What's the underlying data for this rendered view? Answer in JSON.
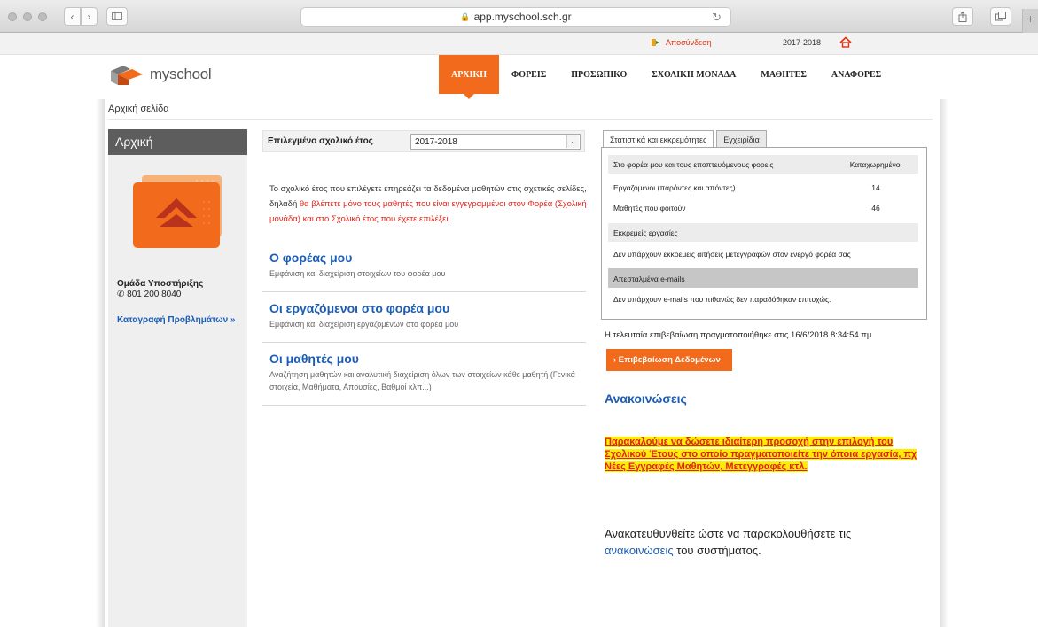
{
  "browser": {
    "url": "app.myschool.sch.gr",
    "icons": [
      "close-dot",
      "minimize-dot",
      "zoom-dot",
      "back-icon",
      "forward-icon",
      "sidebar-icon",
      "lock-icon",
      "reload-icon",
      "share-icon",
      "tabs-icon",
      "new-tab-icon"
    ]
  },
  "topbar": {
    "logout_label": "Αποσύνδεση",
    "school_year": "2017-2018",
    "colors": {
      "logout": "#e0300e"
    }
  },
  "header": {
    "logo_text": "myschool",
    "nav": [
      {
        "label": "ΑΡΧΙΚΗ",
        "active": true
      },
      {
        "label": "ΦΟΡΕΙΣ"
      },
      {
        "label": "ΠΡΟΣΩΠΙΚΟ"
      },
      {
        "label": "ΣΧΟΛΙΚΗ ΜΟΝΑΔΑ"
      },
      {
        "label": "ΜΑΘΗΤΕΣ"
      },
      {
        "label": "ΑΝΑΦΟΡΕΣ"
      }
    ],
    "accent": "#f26a1b"
  },
  "breadcrumb": "Αρχική σελίδα",
  "sidebar": {
    "title": "Αρχική",
    "support_title": "Ομάδα Υποστήριξης",
    "phone": "801 200 8040",
    "report_link": "Καταγραφή Προβλημάτων »"
  },
  "main": {
    "year_label": "Επιλεγμένο σχολικό έτος",
    "year_value": "2017-2018",
    "intro_black": "Το σχολικό έτος που επιλέγετε επηρεάζει τα δεδομένα μαθητών στις σχετικές σελίδες, δηλαδή ",
    "intro_red": "θα βλέπετε μόνο τους μαθητές που είναι εγγεγραμμένοι στον Φορέα (Σχολική μονάδα) και στο Σχολικό έτος που έχετε επιλέξει.",
    "sections": [
      {
        "title": "Ο φορέας μου",
        "desc": "Εμφάνιση και διαχείριση στοιχείων του φορέα μου"
      },
      {
        "title": "Οι εργαζόμενοι στο φορέα μου",
        "desc": "Εμφάνιση και διαχείριση εργαζομένων στο φορέα μου"
      },
      {
        "title": "Οι μαθητές μου",
        "desc": "Αναζήτηση μαθητών και αναλυτική διαχείριση όλων των στοιχείων κάθε μαθητή (Γενικά στοιχεία, Μαθήματα, Απουσίες, Βαθμοί κλπ...)"
      }
    ]
  },
  "right": {
    "tabs": [
      "Στατιστικά και εκκρεμότητες",
      "Εγχειρίδια"
    ],
    "stats_header": "Στο φορέα μου και τους εποπτευόμενους φορείς",
    "stats_col": "Καταχωρημένοι",
    "employees_label": "Εργαζόμενοι (παρόντες και απόντες)",
    "employees_value": "14",
    "students_label": "Μαθητές που φοιτούν",
    "students_value": "46",
    "pending_title": "Εκκρεμείς εργασίες",
    "pending_text": "Δεν υπάρχουν εκκρεμείς αιτήσεις μετεγγραφών στον ενεργό φορέα σας",
    "emails_title": "Απεσταλμένα e-mails",
    "emails_text": "Δεν υπάρχουν e-mails που πιθανώς δεν παραδόθηκαν επιτυχώς.",
    "last_confirm": "Η τελευταία επιβεβαίωση πραγματοποιήθηκε στις 16/6/2018 8:34:54 πμ",
    "confirm_button": "› Επιβεβαίωση Δεδομένων",
    "announcements_title": "Ανακοινώσεις",
    "warning": "Παρακαλούμε να δώσετε ιδιαίτερη προσοχή στην επιλογή του Σχολικού Έτους στο οποίο πραγματοποιείτε την όποια εργασία, πχ Νέες Εγγραφές Μαθητών, Μετεγγραφές κτλ.",
    "note_before": "Ανακατευθυνθείτε ώστε να παρακολουθήσετε τις ",
    "note_link": "ανακοινώσεις",
    "note_after": " του συστήματος.",
    "colors": {
      "link": "#1a5db7",
      "warning_bg": "#ffee00",
      "warning_text": "#e02020"
    }
  }
}
